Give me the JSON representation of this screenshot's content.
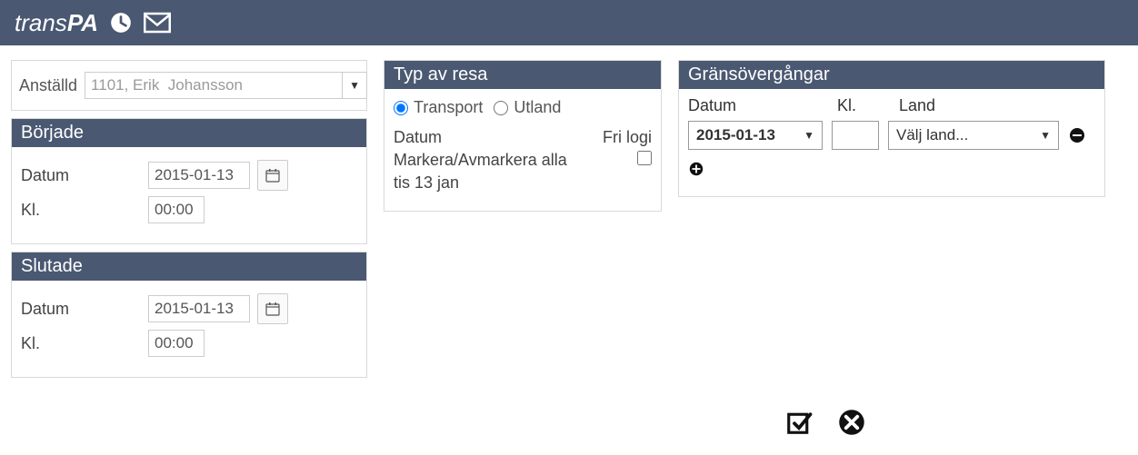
{
  "top": {},
  "employee": {
    "label": "Anställd",
    "value": "1101, Erik  Johansson"
  },
  "start": {
    "header": "Började",
    "date_label": "Datum",
    "date": "2015-01-13",
    "time_label": "Kl.",
    "time": "00:00"
  },
  "end": {
    "header": "Slutade",
    "date_label": "Datum",
    "date": "2015-01-13",
    "time_label": "Kl.",
    "time": "00:00"
  },
  "trip": {
    "header": "Typ av resa",
    "opt_transport": "Transport",
    "opt_abroad": "Utland",
    "col_date": "Datum",
    "col_free": "Fri logi",
    "mark_all": "Markera/Avmarkera alla",
    "day": "tis 13 jan"
  },
  "border": {
    "header": "Gränsövergångar",
    "col_date": "Datum",
    "col_time": "Kl.",
    "col_country": "Land",
    "row": {
      "date": "2015-01-13",
      "time": "",
      "country": "Välj land..."
    }
  }
}
